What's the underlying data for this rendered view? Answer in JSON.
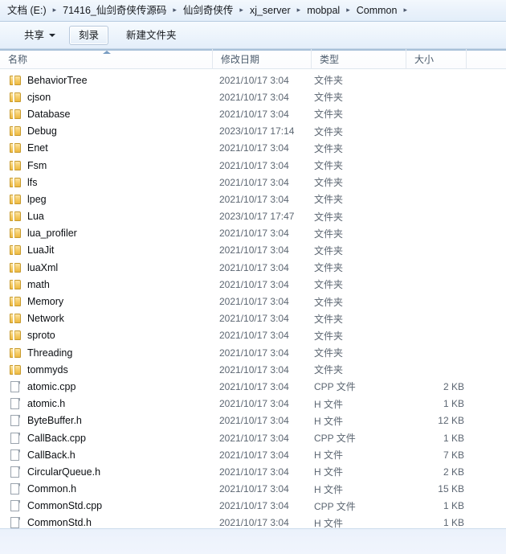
{
  "window": {
    "title": "Windows Explorer"
  },
  "addressbar": {
    "separator": "▸",
    "crumbs": [
      {
        "label": "文档 (E:)"
      },
      {
        "label": "71416_仙剑奇侠传源码"
      },
      {
        "label": "仙剑奇侠传"
      },
      {
        "label": "xj_server"
      },
      {
        "label": "mobpal"
      },
      {
        "label": "Common"
      }
    ]
  },
  "toolbar": {
    "share_label": "共享",
    "burn_label": "刻录",
    "new_folder_label": "新建文件夹"
  },
  "columns": {
    "name": "名称",
    "date_modified": "修改日期",
    "type": "类型",
    "size": "大小",
    "sort_column": "name",
    "sort_direction": "ascending"
  },
  "rows": [
    {
      "icon": "folder",
      "name": "BehaviorTree",
      "date": "2021/10/17 3:04",
      "type": "文件夹",
      "size": ""
    },
    {
      "icon": "folder",
      "name": "cjson",
      "date": "2021/10/17 3:04",
      "type": "文件夹",
      "size": ""
    },
    {
      "icon": "folder",
      "name": "Database",
      "date": "2021/10/17 3:04",
      "type": "文件夹",
      "size": ""
    },
    {
      "icon": "folder",
      "name": "Debug",
      "date": "2023/10/17 17:14",
      "type": "文件夹",
      "size": ""
    },
    {
      "icon": "folder",
      "name": "Enet",
      "date": "2021/10/17 3:04",
      "type": "文件夹",
      "size": ""
    },
    {
      "icon": "folder",
      "name": "Fsm",
      "date": "2021/10/17 3:04",
      "type": "文件夹",
      "size": ""
    },
    {
      "icon": "folder",
      "name": "lfs",
      "date": "2021/10/17 3:04",
      "type": "文件夹",
      "size": ""
    },
    {
      "icon": "folder",
      "name": "lpeg",
      "date": "2021/10/17 3:04",
      "type": "文件夹",
      "size": ""
    },
    {
      "icon": "folder",
      "name": "Lua",
      "date": "2023/10/17 17:47",
      "type": "文件夹",
      "size": ""
    },
    {
      "icon": "folder",
      "name": "lua_profiler",
      "date": "2021/10/17 3:04",
      "type": "文件夹",
      "size": ""
    },
    {
      "icon": "folder",
      "name": "LuaJit",
      "date": "2021/10/17 3:04",
      "type": "文件夹",
      "size": ""
    },
    {
      "icon": "folder",
      "name": "luaXml",
      "date": "2021/10/17 3:04",
      "type": "文件夹",
      "size": ""
    },
    {
      "icon": "folder",
      "name": "math",
      "date": "2021/10/17 3:04",
      "type": "文件夹",
      "size": ""
    },
    {
      "icon": "folder",
      "name": "Memory",
      "date": "2021/10/17 3:04",
      "type": "文件夹",
      "size": ""
    },
    {
      "icon": "folder",
      "name": "Network",
      "date": "2021/10/17 3:04",
      "type": "文件夹",
      "size": ""
    },
    {
      "icon": "folder",
      "name": "sproto",
      "date": "2021/10/17 3:04",
      "type": "文件夹",
      "size": ""
    },
    {
      "icon": "folder",
      "name": "Threading",
      "date": "2021/10/17 3:04",
      "type": "文件夹",
      "size": ""
    },
    {
      "icon": "folder",
      "name": "tommyds",
      "date": "2021/10/17 3:04",
      "type": "文件夹",
      "size": ""
    },
    {
      "icon": "file",
      "name": "atomic.cpp",
      "date": "2021/10/17 3:04",
      "type": "CPP 文件",
      "size": "2 KB"
    },
    {
      "icon": "file",
      "name": "atomic.h",
      "date": "2021/10/17 3:04",
      "type": "H 文件",
      "size": "1 KB"
    },
    {
      "icon": "file",
      "name": "ByteBuffer.h",
      "date": "2021/10/17 3:04",
      "type": "H 文件",
      "size": "12 KB"
    },
    {
      "icon": "file",
      "name": "CallBack.cpp",
      "date": "2021/10/17 3:04",
      "type": "CPP 文件",
      "size": "1 KB"
    },
    {
      "icon": "file",
      "name": "CallBack.h",
      "date": "2021/10/17 3:04",
      "type": "H 文件",
      "size": "7 KB"
    },
    {
      "icon": "file",
      "name": "CircularQueue.h",
      "date": "2021/10/17 3:04",
      "type": "H 文件",
      "size": "2 KB"
    },
    {
      "icon": "file",
      "name": "Common.h",
      "date": "2021/10/17 3:04",
      "type": "H 文件",
      "size": "15 KB"
    },
    {
      "icon": "file",
      "name": "CommonStd.cpp",
      "date": "2021/10/17 3:04",
      "type": "CPP 文件",
      "size": "1 KB"
    },
    {
      "icon": "file",
      "name": "CommonStd.h",
      "date": "2021/10/17 3:04",
      "type": "H 文件",
      "size": "1 KB"
    }
  ],
  "colors": {
    "chrome_blue": "#e3eef9",
    "folder_yellow": "#f7cf6e",
    "header_text": "#4a5a6b",
    "row_text": "#0b0e12",
    "meta_text": "#5c6672"
  }
}
